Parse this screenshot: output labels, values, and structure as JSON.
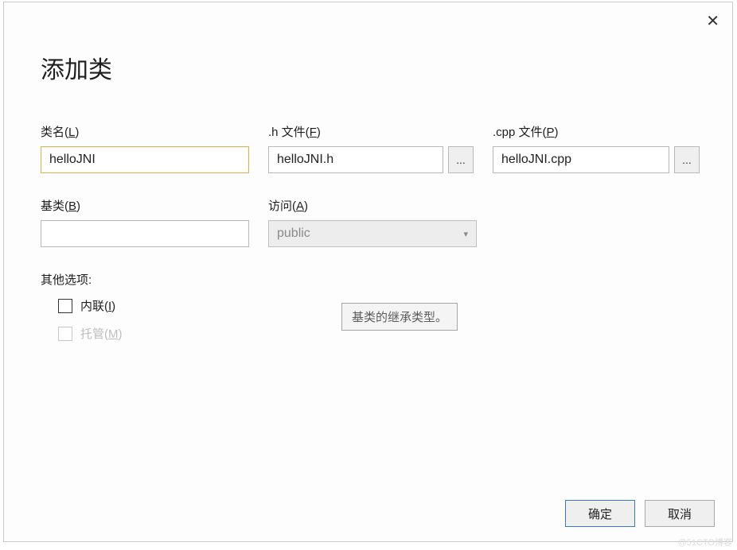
{
  "dialog": {
    "title": "添加类",
    "close_symbol": "✕"
  },
  "fields": {
    "class_name": {
      "label_pre": "类名(",
      "hotkey": "L",
      "label_post": ")",
      "value": "helloJNI"
    },
    "h_file": {
      "label_pre": ".h 文件(",
      "hotkey": "F",
      "label_post": ")",
      "value": "helloJNI.h",
      "browse": "..."
    },
    "cpp_file": {
      "label_pre": ".cpp 文件(",
      "hotkey": "P",
      "label_post": ")",
      "value": "helloJNI.cpp",
      "browse": "..."
    },
    "base_class": {
      "label_pre": "基类(",
      "hotkey": "B",
      "label_post": ")",
      "value": ""
    },
    "access": {
      "label_pre": "访问(",
      "hotkey": "A",
      "label_post": ")",
      "value": "public"
    }
  },
  "options": {
    "heading": "其他选项:",
    "inline": {
      "label_pre": "内联(",
      "hotkey": "I",
      "label_post": ")",
      "checked": false,
      "enabled": true
    },
    "managed": {
      "label_pre": "托管(",
      "hotkey": "M",
      "label_post": ")",
      "checked": false,
      "enabled": false
    }
  },
  "tooltip": "基类的继承类型。",
  "buttons": {
    "ok": "确定",
    "cancel": "取消"
  },
  "watermark": "@51CTO博客"
}
